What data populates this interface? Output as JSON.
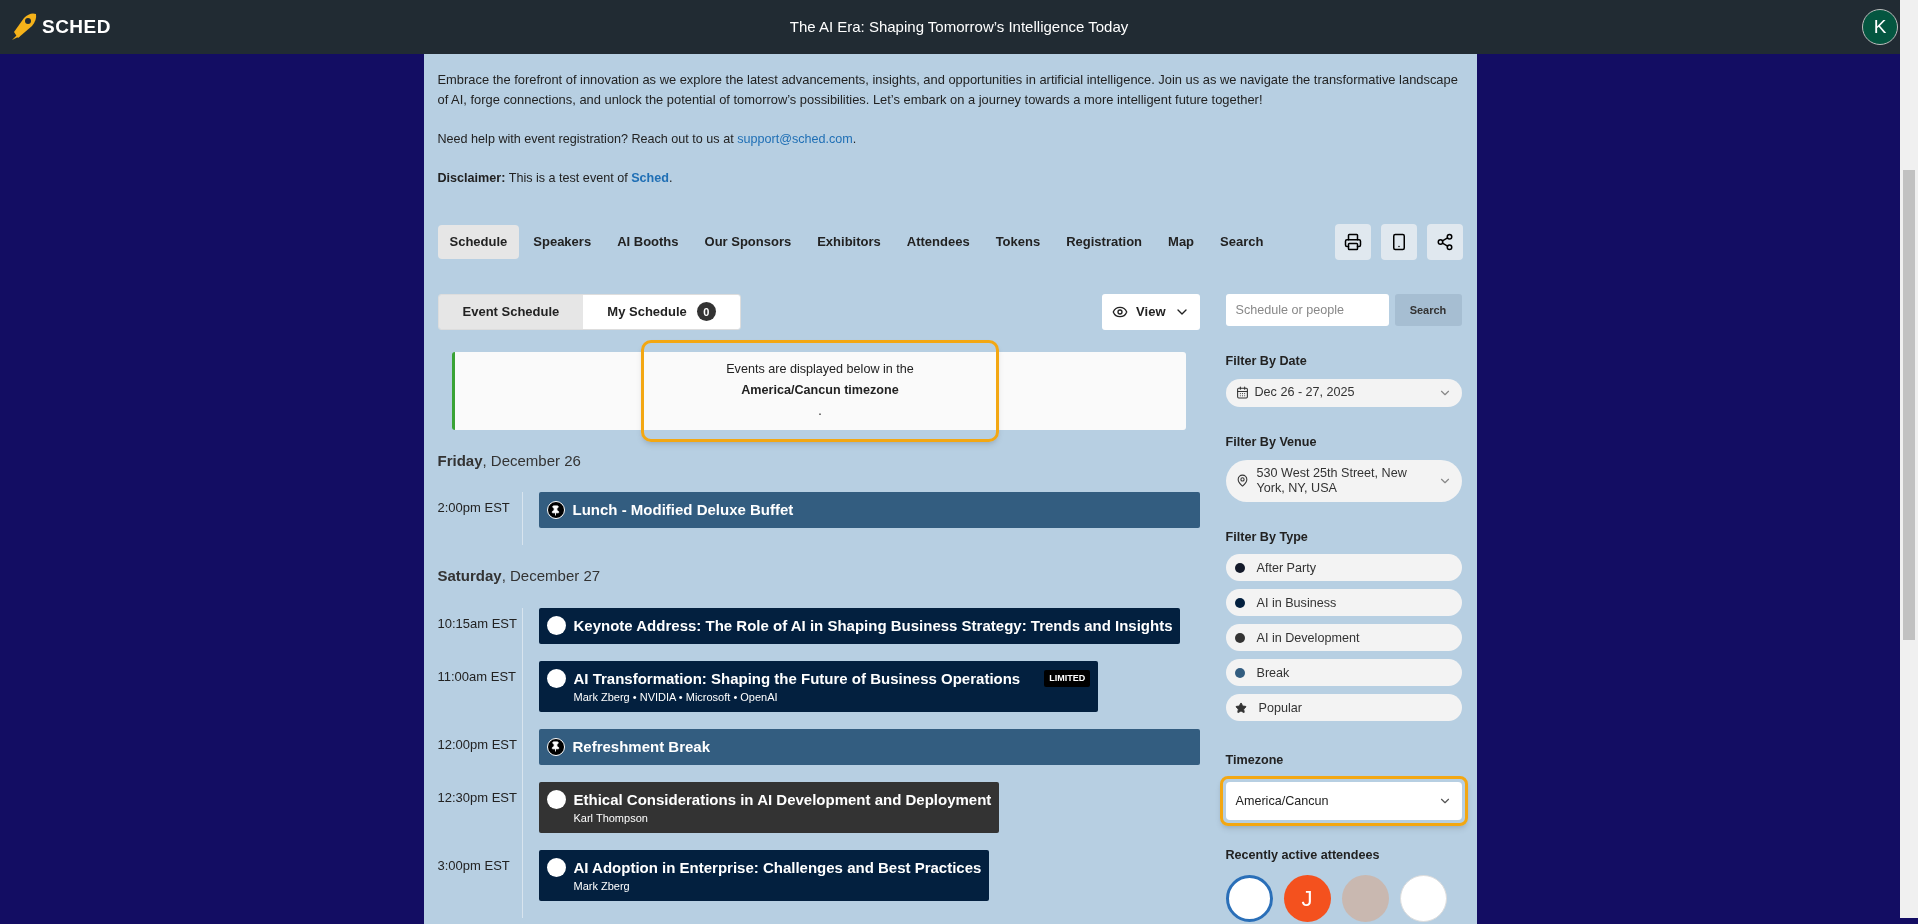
{
  "header": {
    "logo": "SCHED",
    "title": "The AI Era: Shaping Tomorrow’s Intelligence Today",
    "user_initial": "K"
  },
  "intro": {
    "description": "Embrace the forefront of innovation as we explore the latest advancements, insights, and opportunities in artificial intelligence. Join us as we navigate the transformative landscape of AI, forge connections, and unlock the potential of tomorrow’s possibilities. Let’s embark on a journey towards a more intelligent future together!",
    "help_text": "Need help with event registration? Reach out to us at",
    "help_link": "support@sched.com",
    "help_end": ".",
    "disclaimer_label": "Disclaimer:",
    "disclaimer_text": "This is a test event of",
    "disclaimer_link": "Sched",
    "disclaimer_end": "."
  },
  "tabs": [
    {
      "label": "Schedule",
      "selected": true
    },
    {
      "label": "Speakers",
      "selected": false
    },
    {
      "label": "AI Booths",
      "selected": false
    },
    {
      "label": "Our Sponsors",
      "selected": false
    },
    {
      "label": "Exhibitors",
      "selected": false
    },
    {
      "label": "Attendees",
      "selected": false
    },
    {
      "label": "Tokens",
      "selected": false
    },
    {
      "label": "Registration",
      "selected": false
    },
    {
      "label": "Map",
      "selected": false
    },
    {
      "label": "Search",
      "selected": false
    }
  ],
  "schedule_toggle": [
    {
      "label": "Event Schedule",
      "selected": true
    },
    {
      "label": "My Schedule",
      "selected": false,
      "count": "0"
    }
  ],
  "view_button": "View",
  "notice": {
    "line1": "Events are displayed below in the",
    "line2": "America/Cancun timezone",
    "line3": ".",
    "highlighted": true
  },
  "days": [
    {
      "weekday": "Friday",
      "date": ", December 26",
      "slots": [
        {
          "time": "2:00pm EST",
          "kind": "break",
          "color": "#335d80",
          "title": "Lunch - Modified Deluxe Buffet"
        }
      ]
    },
    {
      "weekday": "Saturday",
      "date": ", December 27",
      "slots": [
        {
          "time": "10:15am EST",
          "kind": "session",
          "color": "#03203f",
          "title": "Keynote Address: The Role of AI in Shaping Business Strategy: Trends and Insights"
        },
        {
          "time": "11:00am EST",
          "kind": "session",
          "color": "#03203f",
          "title": "AI Transformation: Shaping the Future of Business Operations",
          "speakers": "Mark Zberg • NVIDIA • Microsoft • OpenAI",
          "badge": "LIMITED"
        },
        {
          "time": "12:00pm EST",
          "kind": "break",
          "color": "#335d80",
          "title": "Refreshment Break"
        },
        {
          "time": "12:30pm EST",
          "kind": "session",
          "color": "#333333",
          "title": "Ethical Considerations in AI Development and Deployment",
          "speakers": "Karl Thompson"
        },
        {
          "time": "3:00pm EST",
          "kind": "session",
          "color": "#03203f",
          "title": "AI Adoption in Enterprise: Challenges and Best Practices",
          "speakers": "Mark Zberg"
        }
      ]
    }
  ],
  "sidebar": {
    "search": {
      "placeholder": "Schedule or people",
      "button": "Search"
    },
    "date_label": "Filter By Date",
    "date_value": "Dec 26 - 27, 2025",
    "venue_label": "Filter By Venue",
    "venue_value": "530 West 25th Street, New York, NY, USA",
    "type_label": "Filter By Type",
    "types": [
      {
        "label": "After Party",
        "kind": "dot",
        "color": "#141a2a"
      },
      {
        "label": "AI in Business",
        "kind": "dot",
        "color": "#03203f"
      },
      {
        "label": "AI in Development",
        "kind": "dot",
        "color": "#333333"
      },
      {
        "label": "Break",
        "kind": "dot",
        "color": "#335d80"
      },
      {
        "label": "Popular",
        "kind": "star"
      }
    ],
    "timezone_label": "Timezone",
    "timezone_value": "America/Cancun",
    "timezone_highlighted": true,
    "attendees_label": "Recently active attendees",
    "attendees": [
      {
        "kind": "badge"
      },
      {
        "kind": "initial",
        "initial": "J"
      },
      {
        "kind": "photo"
      },
      {
        "kind": "logo"
      }
    ]
  }
}
